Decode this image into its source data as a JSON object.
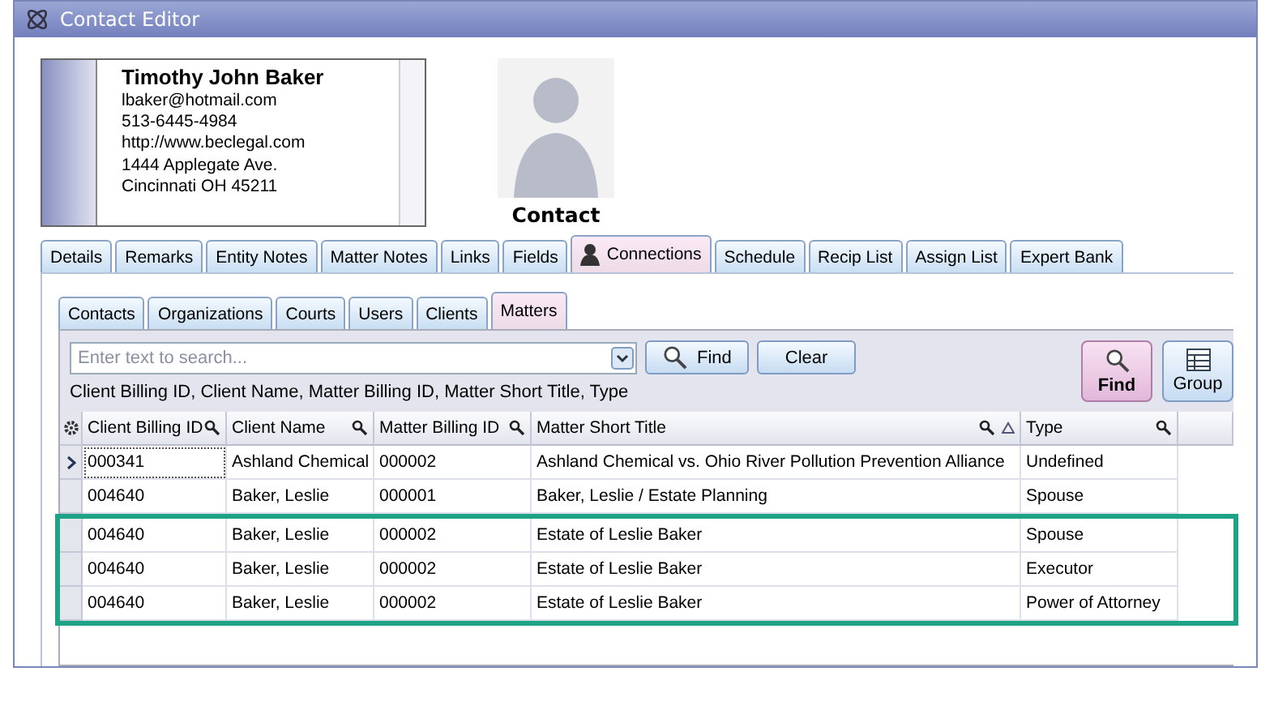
{
  "window": {
    "title": "Contact Editor"
  },
  "contact_card": {
    "name": "Timothy John Baker",
    "lines": [
      "lbaker@hotmail.com",
      "513-6445-4984",
      "http://www.beclegal.com",
      "1444 Applegate Ave.",
      "Cincinnati OH 45211"
    ]
  },
  "photo_caption": "Contact",
  "tabs": [
    {
      "label": "Details",
      "selected": false
    },
    {
      "label": "Remarks",
      "selected": false
    },
    {
      "label": "Entity Notes",
      "selected": false
    },
    {
      "label": "Matter Notes",
      "selected": false
    },
    {
      "label": "Links",
      "selected": false
    },
    {
      "label": "Fields",
      "selected": false
    },
    {
      "label": "Connections",
      "selected": true
    },
    {
      "label": "Schedule",
      "selected": false
    },
    {
      "label": "Recip List",
      "selected": false
    },
    {
      "label": "Assign List",
      "selected": false
    },
    {
      "label": "Expert Bank",
      "selected": false
    }
  ],
  "subtabs": [
    {
      "label": "Contacts",
      "selected": false
    },
    {
      "label": "Organizations",
      "selected": false
    },
    {
      "label": "Courts",
      "selected": false
    },
    {
      "label": "Users",
      "selected": false
    },
    {
      "label": "Clients",
      "selected": false
    },
    {
      "label": "Matters",
      "selected": true
    }
  ],
  "search": {
    "placeholder": "Enter text to search...",
    "find": "Find",
    "clear": "Clear",
    "fields_hint": "Client Billing ID, Client Name, Matter Billing ID, Matter Short Title, Type"
  },
  "toolbar": [
    {
      "label": "Find",
      "selected": true,
      "kind": "find"
    },
    {
      "label": "Group",
      "selected": false,
      "kind": "group"
    }
  ],
  "table": {
    "columns": [
      "Client Billing ID",
      "Client Name",
      "Matter Billing ID",
      "Matter Short Title",
      "Type"
    ],
    "rows": [
      {
        "selected": true,
        "highlighted": false,
        "cells": [
          "000341",
          "Ashland Chemical",
          "000002",
          "Ashland Chemical vs. Ohio River Pollution Prevention Alliance",
          "Undefined"
        ]
      },
      {
        "selected": false,
        "highlighted": false,
        "cells": [
          "004640",
          "Baker, Leslie",
          "000001",
          "Baker, Leslie / Estate Planning",
          "Spouse"
        ]
      },
      {
        "selected": false,
        "highlighted": true,
        "cells": [
          "004640",
          "Baker, Leslie",
          "000002",
          "Estate of Leslie Baker",
          "Spouse"
        ]
      },
      {
        "selected": false,
        "highlighted": true,
        "cells": [
          "004640",
          "Baker, Leslie",
          "000002",
          "Estate of Leslie Baker",
          "Executor"
        ]
      },
      {
        "selected": false,
        "highlighted": true,
        "cells": [
          "004640",
          "Baker, Leslie",
          "000002",
          "Estate of Leslie Baker",
          "Power of Attorney"
        ]
      }
    ]
  }
}
